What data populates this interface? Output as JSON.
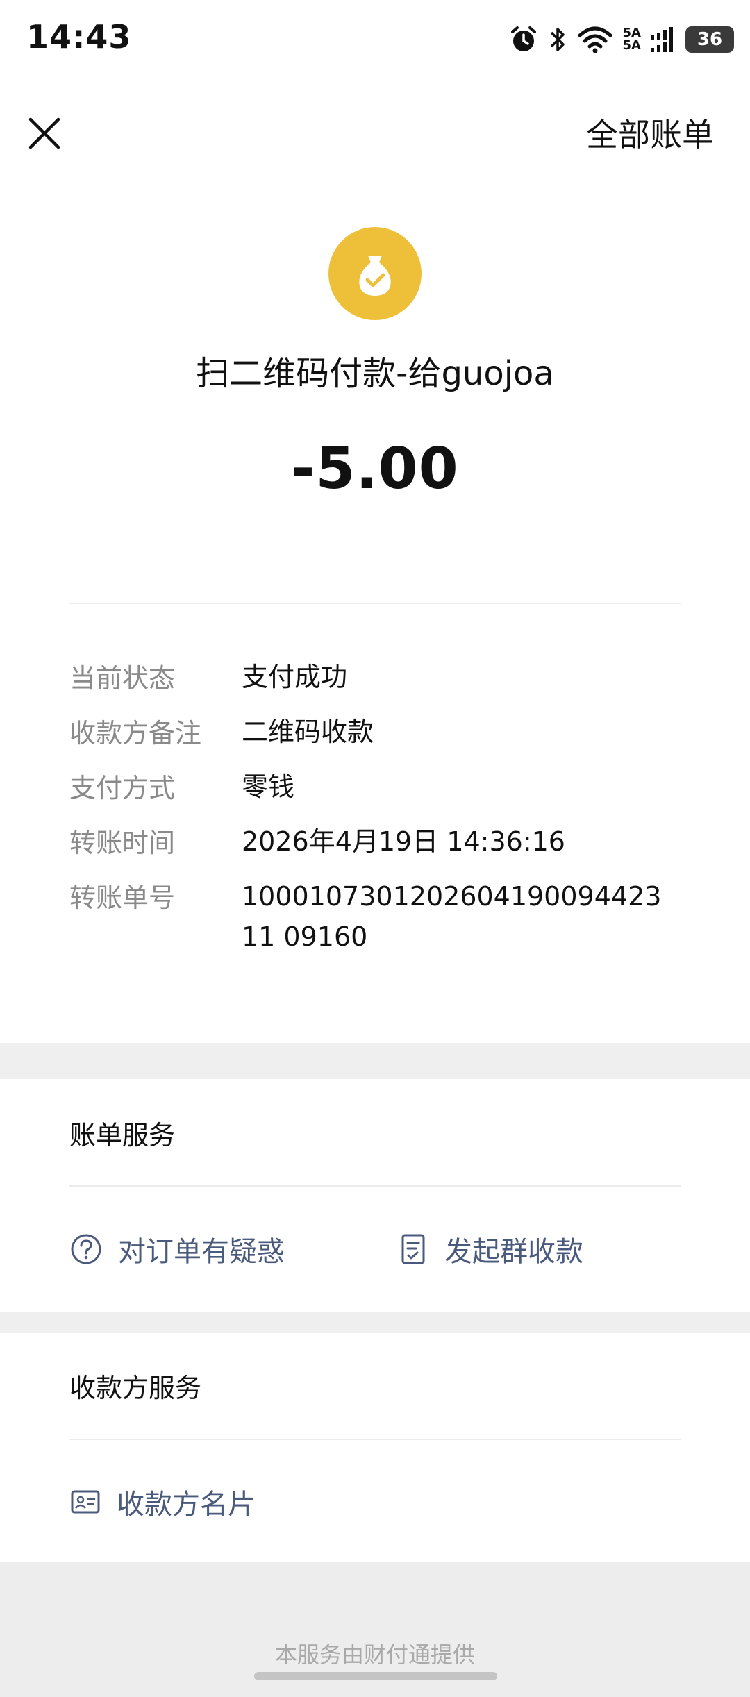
{
  "status_bar": {
    "time": "14:43",
    "network_top": "5A",
    "network_bottom": "5A",
    "battery": "36",
    "icons": [
      "alarm-icon",
      "bluetooth-icon",
      "wifi-icon",
      "signal-icon",
      "battery-icon"
    ]
  },
  "header": {
    "close_icon": "close-icon",
    "all_bills": "全部账单"
  },
  "summary": {
    "logo_icon": "money-bag-check-icon",
    "logo_color": "#eec03a",
    "title": "扫二维码付款-给guojoa",
    "amount": "-5.00"
  },
  "details": [
    {
      "label": "当前状态",
      "value": "支付成功"
    },
    {
      "label": "收款方备注",
      "value": "二维码收款"
    },
    {
      "label": "支付方式",
      "value": "零钱"
    },
    {
      "label": "转账时间",
      "value": "2026年4月19日 14:36:16"
    },
    {
      "label": "转账单号",
      "value": "100010730120260419009442311 09160"
    }
  ],
  "bill_service": {
    "title": "账单服务",
    "actions": [
      {
        "label": "对订单有疑惑",
        "icon": "question-circle-icon"
      },
      {
        "label": "发起群收款",
        "icon": "checklist-icon"
      }
    ]
  },
  "payee_service": {
    "title": "收款方服务",
    "actions": [
      {
        "label": "收款方名片",
        "icon": "contact-card-icon"
      }
    ]
  },
  "footer": {
    "provider": "本服务由财付通提供"
  },
  "colors": {
    "link": "#4a5a7c",
    "label_gray": "#8a8a8a",
    "band_gray": "#efefef"
  }
}
